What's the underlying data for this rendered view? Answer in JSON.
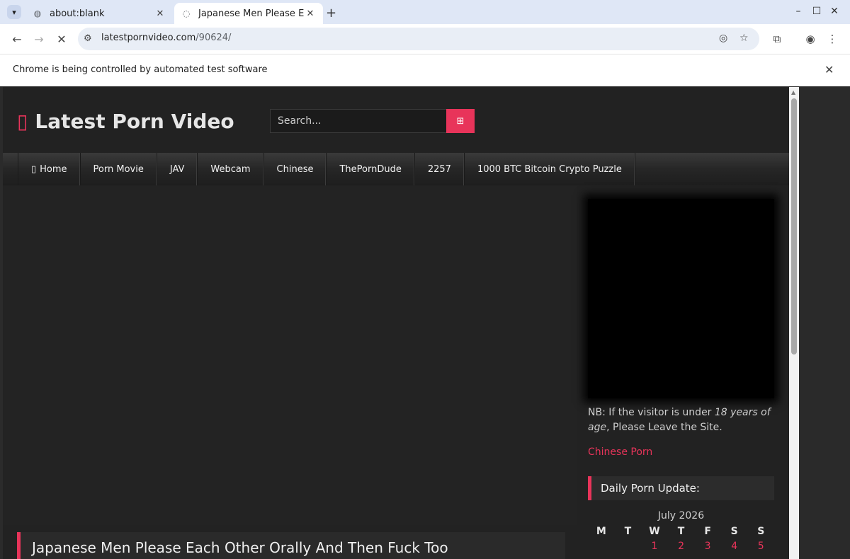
{
  "browser": {
    "tabs": [
      {
        "title": "about:blank",
        "icon": "globe-icon"
      },
      {
        "title": "Japanese Men Please Each",
        "icon": "loading-icon"
      }
    ],
    "url": {
      "host": "latestpornvideo.com",
      "path": "/90624/"
    },
    "infobar": "Chrome is being controlled by automated test software"
  },
  "site": {
    "logo": "Latest Porn Video",
    "search_placeholder": "Search...",
    "menu": [
      "Home",
      "Porn Movie",
      "JAV",
      "Webcam",
      "Chinese",
      "ThePornDude",
      "2257",
      "1000 BTC Bitcoin Crypto Puzzle"
    ],
    "notice": {
      "before": "NB: If the visitor is under ",
      "emph": "18 years of age",
      "after": ", Please Leave the Site."
    },
    "sidebar_link": "Chinese Porn",
    "widget_title": "Daily Porn Update:",
    "calendar": {
      "caption": "July 2026",
      "weekdays": [
        "M",
        "T",
        "W",
        "T",
        "F",
        "S",
        "S"
      ],
      "first_row": [
        "",
        "",
        "1",
        "2",
        "3",
        "4",
        "5"
      ]
    },
    "post_title": "Japanese Men Please Each Other Orally And Then Fuck Too"
  },
  "colors": {
    "accent": "#e8345a",
    "page_bg": "#222222"
  }
}
